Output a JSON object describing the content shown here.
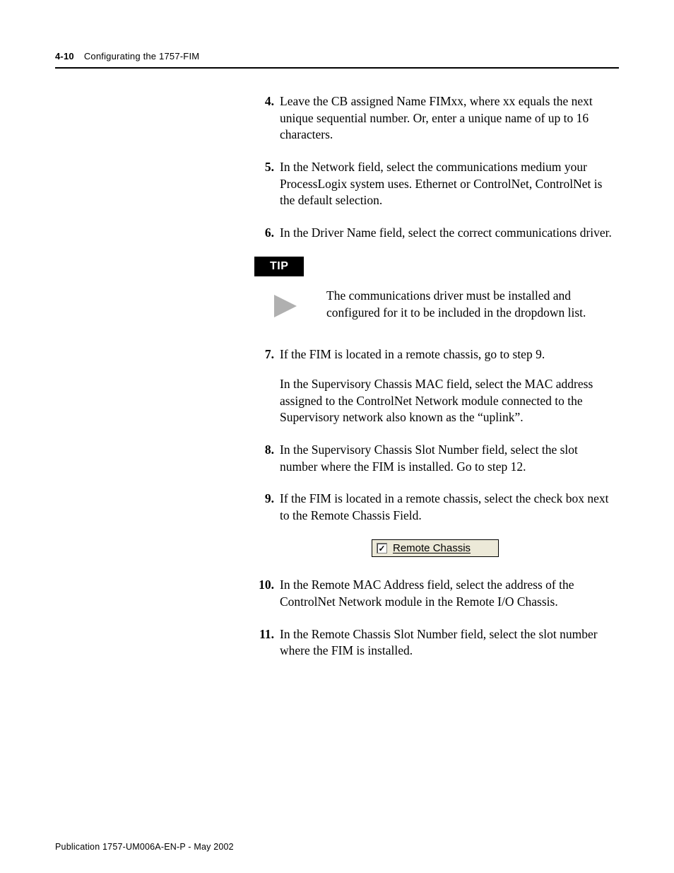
{
  "header": {
    "page_number": "4-10",
    "section_title": "Configurating the 1757-FIM"
  },
  "steps": {
    "s4": {
      "num": "4.",
      "text": "Leave the CB assigned Name FIMxx, where xx equals the next unique sequential number. Or, enter a unique name of up to 16 characters."
    },
    "s5": {
      "num": "5.",
      "text": "In the Network field, select the communications medium your ProcessLogix system uses. Ethernet or ControlNet, ControlNet is the default selection."
    },
    "s6": {
      "num": "6.",
      "text": "In the Driver Name field, select the correct communications driver."
    },
    "s7": {
      "num": "7.",
      "p1": "If the FIM is located in a remote chassis, go to step 9.",
      "p2": "In the Supervisory Chassis MAC field, select the MAC address assigned to the ControlNet Network module connected to the Supervisory network also known as the “uplink”."
    },
    "s8": {
      "num": "8.",
      "text": "In the Supervisory Chassis Slot Number field, select the slot number where the FIM is installed. Go to step 12."
    },
    "s9": {
      "num": "9.",
      "text": "If the FIM is located in a remote chassis, select the check box next to the Remote Chassis Field."
    },
    "s10": {
      "num": "10.",
      "text": "In the Remote MAC Address field, select the address of the ControlNet Network module in the Remote I/O Chassis."
    },
    "s11": {
      "num": "11.",
      "text": "In the Remote Chassis Slot Number field, select the slot number where the FIM is installed."
    }
  },
  "tip": {
    "label": "TIP",
    "text": "The communications driver must be installed and configured for it to be included in the dropdown list."
  },
  "checkbox": {
    "label": "Remote Chassis",
    "checked": true
  },
  "footer": {
    "text": "Publication 1757-UM006A-EN-P - May 2002"
  }
}
